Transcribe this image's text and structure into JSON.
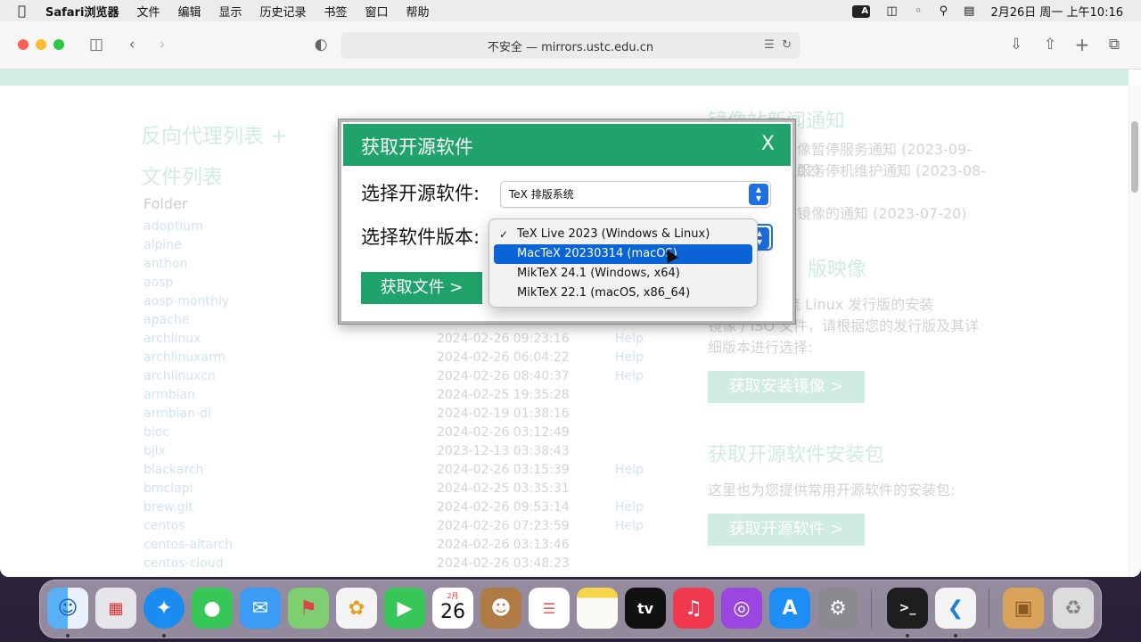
{
  "menubar": {
    "apple": "",
    "app_name": "Safari浏览器",
    "menus": [
      "文件",
      "编辑",
      "显示",
      "历史记录",
      "书签",
      "窗口",
      "帮助"
    ],
    "input_method": "A",
    "datetime": "2月26日 周一 上午10:16"
  },
  "browser": {
    "url": "不安全 — mirrors.ustc.edu.cn",
    "colors": {
      "close": "#fe5f57",
      "minimize": "#febc2e",
      "zoom": "#28c840"
    }
  },
  "page": {
    "left_title_1": "反向代理列表 +",
    "left_title_2": "文件列表",
    "folder_header": "Folder",
    "mirrors": [
      {
        "name": "adoptium",
        "date": "",
        "help": ""
      },
      {
        "name": "alpine",
        "date": "",
        "help": ""
      },
      {
        "name": "anthon",
        "date": "",
        "help": ""
      },
      {
        "name": "aosp",
        "date": "",
        "help": ""
      },
      {
        "name": "aosp-monthly",
        "date": "",
        "help": ""
      },
      {
        "name": "apache",
        "date": "",
        "help": ""
      },
      {
        "name": "archlinux",
        "date": "2024-02-26 09:23:16",
        "help": "Help"
      },
      {
        "name": "archlinuxarm",
        "date": "2024-02-26 06:04:22",
        "help": "Help"
      },
      {
        "name": "archlinuxcn",
        "date": "2024-02-26 08:40:37",
        "help": "Help"
      },
      {
        "name": "armbian",
        "date": "2024-02-25 19:35:28",
        "help": ""
      },
      {
        "name": "armbian-dl",
        "date": "2024-02-19 01:38:16",
        "help": ""
      },
      {
        "name": "bioc",
        "date": "2024-02-26 03:12:49",
        "help": ""
      },
      {
        "name": "bjlx",
        "date": "2023-12-13 03:38:43",
        "help": ""
      },
      {
        "name": "blackarch",
        "date": "2024-02-26 03:15:39",
        "help": "Help"
      },
      {
        "name": "bmclapi",
        "date": "2024-02-25 03:35:31",
        "help": ""
      },
      {
        "name": "brew.git",
        "date": "2024-02-26 09:53:14",
        "help": "Help"
      },
      {
        "name": "centos",
        "date": "2024-02-26 07:23:59",
        "help": "Help"
      },
      {
        "name": "centos-altarch",
        "date": "2024-02-26 03:13:46",
        "help": ""
      },
      {
        "name": "centos-cloud",
        "date": "2024-02-26 03:48:23",
        "help": ""
      }
    ],
    "right": {
      "news_title": "镜像站新闻通知",
      "news_1": "像暂停服务通知 (2023-09-02)",
      "news_2": "服务停机维护通知 (2023-08-",
      "news_3": "镜像的通知 (2023-07-20)",
      "iso_title": "版映像",
      "iso_text_1": "各大主流 Linux 发行版的安装",
      "iso_text_2": "镜像 / ISO 文件，请根据您的发行版及其详",
      "iso_text_3": "细版本进行选择:",
      "iso_button": "获取安装镜像 >",
      "pkg_title": "获取开源软件安装包",
      "pkg_text": "这里也为您提供常用开源软件的安装包:",
      "pkg_button": "获取开源软件 >"
    }
  },
  "dialog": {
    "title": "获取开源软件",
    "close": "X",
    "software_label": "选择开源软件:",
    "software_value": "TeX 排版系统",
    "version_label": "选择软件版本:",
    "get_file_button": "获取文件 >",
    "version_options": [
      {
        "label": "TeX Live 2023 (Windows & Linux)",
        "checked": true,
        "highlighted": false
      },
      {
        "label": "MacTeX 20230314 (macOS)",
        "checked": false,
        "highlighted": true
      },
      {
        "label": "MikTeX 24.1 (Windows, x64)",
        "checked": false,
        "highlighted": false
      },
      {
        "label": "MikTeX 22.1 (macOS, x86_64)",
        "checked": false,
        "highlighted": false
      }
    ]
  },
  "dock": {
    "calendar_month": "2月",
    "calendar_day": "26",
    "apps": [
      "finder-icon",
      "launchpad-icon",
      "safari-icon",
      "messages-icon",
      "mail-icon",
      "maps-icon",
      "photos-icon",
      "facetime-icon",
      "calendar-icon",
      "contacts-icon",
      "reminders-icon",
      "notes-icon",
      "tv-icon",
      "music-icon",
      "podcasts-icon",
      "appstore-icon",
      "settings-icon",
      "terminal-icon",
      "vscode-icon",
      "installer-icon",
      "trash-icon"
    ]
  }
}
